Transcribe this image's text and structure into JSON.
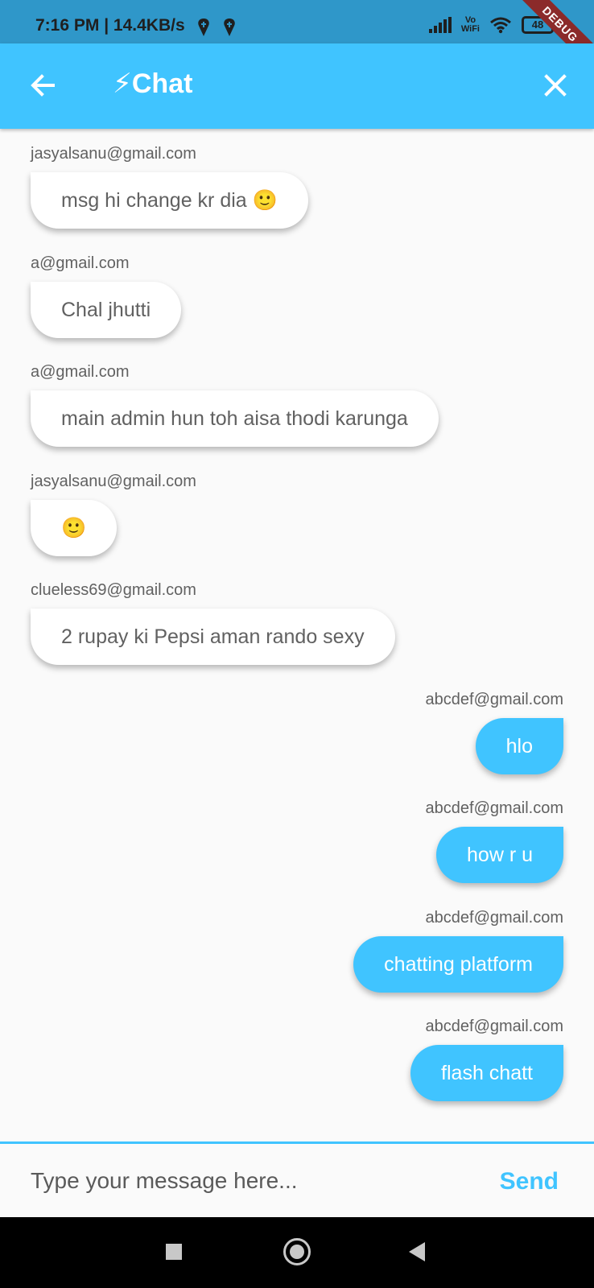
{
  "status_bar": {
    "time": "7:16 PM | 14.4KB/s",
    "vowifi_top": "Vo",
    "vowifi_bottom": "WiFi",
    "battery": "48"
  },
  "debug_banner": "DEBUG",
  "app_bar": {
    "title": "⚡Chat"
  },
  "messages": [
    {
      "sender": "jasyalsanu@gmail.com",
      "text": "msg hi change kr dia 🙂",
      "side": "left"
    },
    {
      "sender": "a@gmail.com",
      "text": "Chal jhutti",
      "side": "left"
    },
    {
      "sender": "a@gmail.com",
      "text": "main admin hun toh aisa thodi karunga",
      "side": "left"
    },
    {
      "sender": "jasyalsanu@gmail.com",
      "text": "🙂",
      "side": "left"
    },
    {
      "sender": "clueless69@gmail.com",
      "text": "2 rupay ki Pepsi aman rando sexy",
      "side": "left"
    },
    {
      "sender": "abcdef@gmail.com",
      "text": "hlo",
      "side": "right"
    },
    {
      "sender": "abcdef@gmail.com",
      "text": "how r u",
      "side": "right"
    },
    {
      "sender": "abcdef@gmail.com",
      "text": "chatting platform",
      "side": "right"
    },
    {
      "sender": "abcdef@gmail.com",
      "text": "flash chatt",
      "side": "right"
    }
  ],
  "composer": {
    "placeholder": "Type your message here...",
    "value": "",
    "send_label": "Send"
  },
  "colors": {
    "accent": "#40c4ff",
    "status_bar": "#2f97c9",
    "received_bubble": "#ffffff",
    "received_text": "#616161"
  }
}
